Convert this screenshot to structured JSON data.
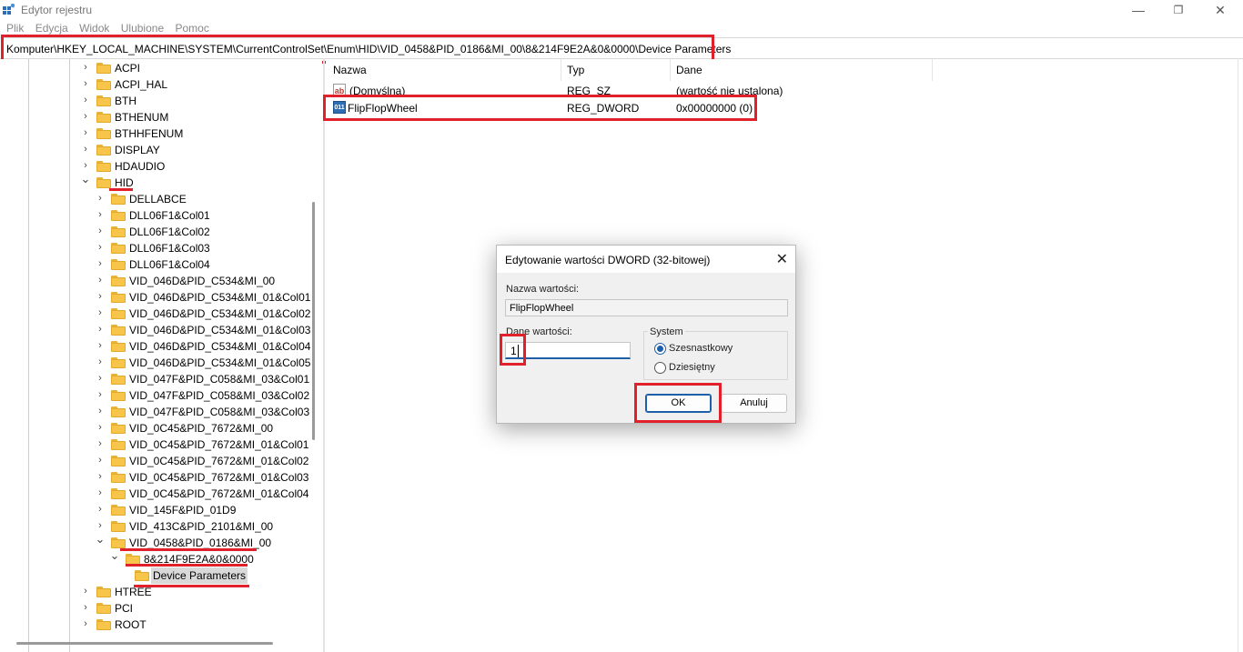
{
  "window": {
    "title": "Edytor rejestru"
  },
  "menu": [
    "Plik",
    "Edycja",
    "Widok",
    "Ulubione",
    "Pomoc"
  ],
  "address": "Komputer\\HKEY_LOCAL_MACHINE\\SYSTEM\\CurrentControlSet\\Enum\\HID\\VID_0458&PID_0186&MI_00\\8&214F9E2A&0&0000\\Device Parameters",
  "tree": {
    "items": [
      {
        "label": "ACPI"
      },
      {
        "label": "ACPI_HAL"
      },
      {
        "label": "BTH"
      },
      {
        "label": "BTHENUM"
      },
      {
        "label": "BTHHFENUM"
      },
      {
        "label": "DISPLAY"
      },
      {
        "label": "HDAUDIO"
      },
      {
        "label": "HID"
      },
      {
        "label": "DELLABCE"
      },
      {
        "label": "DLL06F1&Col01"
      },
      {
        "label": "DLL06F1&Col02"
      },
      {
        "label": "DLL06F1&Col03"
      },
      {
        "label": "DLL06F1&Col04"
      },
      {
        "label": "VID_046D&PID_C534&MI_00"
      },
      {
        "label": "VID_046D&PID_C534&MI_01&Col01"
      },
      {
        "label": "VID_046D&PID_C534&MI_01&Col02"
      },
      {
        "label": "VID_046D&PID_C534&MI_01&Col03"
      },
      {
        "label": "VID_046D&PID_C534&MI_01&Col04"
      },
      {
        "label": "VID_046D&PID_C534&MI_01&Col05"
      },
      {
        "label": "VID_047F&PID_C058&MI_03&Col01"
      },
      {
        "label": "VID_047F&PID_C058&MI_03&Col02"
      },
      {
        "label": "VID_047F&PID_C058&MI_03&Col03"
      },
      {
        "label": "VID_0C45&PID_7672&MI_00"
      },
      {
        "label": "VID_0C45&PID_7672&MI_01&Col01"
      },
      {
        "label": "VID_0C45&PID_7672&MI_01&Col02"
      },
      {
        "label": "VID_0C45&PID_7672&MI_01&Col03"
      },
      {
        "label": "VID_0C45&PID_7672&MI_01&Col04"
      },
      {
        "label": "VID_145F&PID_01D9"
      },
      {
        "label": "VID_413C&PID_2101&MI_00"
      },
      {
        "label": "VID_0458&PID_0186&MI_00"
      },
      {
        "label": "8&214F9E2A&0&0000"
      },
      {
        "label": "Device Parameters"
      },
      {
        "label": "HTREE"
      },
      {
        "label": "PCI"
      },
      {
        "label": "ROOT"
      }
    ]
  },
  "list": {
    "columns": [
      "Nazwa",
      "Typ",
      "Dane"
    ],
    "rows": [
      {
        "icon": "string-value-icon",
        "icon_text": "ab",
        "name": "(Domyślna)",
        "type": "REG_SZ",
        "data": "(wartość nie ustalona)"
      },
      {
        "icon": "binary-value-icon",
        "icon_text": "011",
        "name": "FlipFlopWheel",
        "type": "REG_DWORD",
        "data": "0x00000000 (0)"
      }
    ]
  },
  "dialog": {
    "title": "Edytowanie wartości DWORD (32-bitowej)",
    "close": "✕",
    "name_label": "Nazwa wartości:",
    "name_value": "FlipFlopWheel",
    "data_label": "Dane wartości:",
    "data_value": "1",
    "base_label": "System",
    "options": [
      "Szesnastkowy",
      "Dziesiętny"
    ],
    "selected_option": "Szesnastkowy",
    "ok": "OK",
    "cancel": "Anuluj"
  },
  "colors": {
    "highlight": "#e0202a",
    "accent": "#1f5faa",
    "folder": "#f6c54a"
  }
}
